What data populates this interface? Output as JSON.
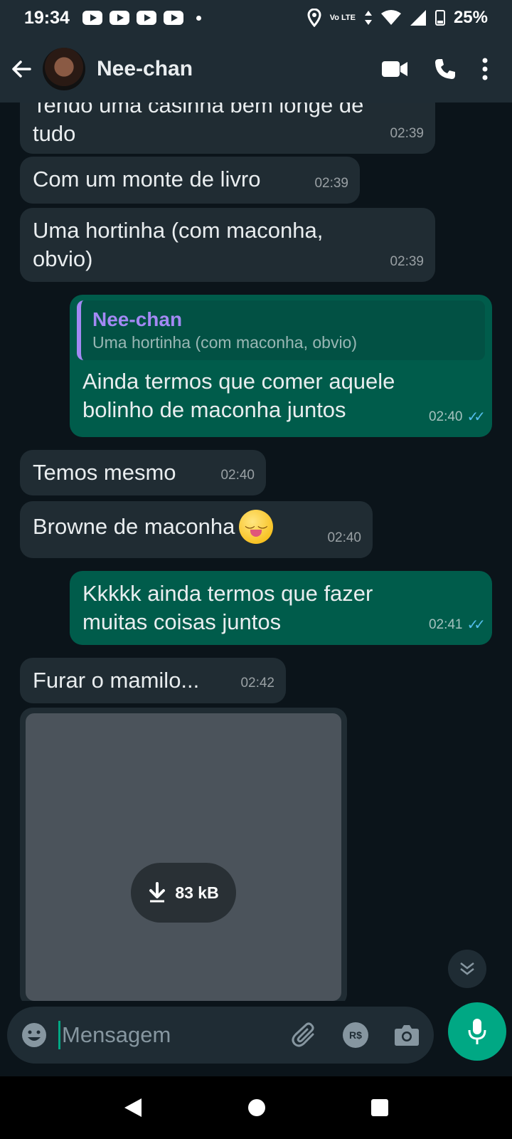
{
  "status_bar": {
    "time": "19:34",
    "network": "Vo LTE",
    "battery": "25%"
  },
  "header": {
    "contact_name": "Nee-chan",
    "icons": [
      "back-arrow-icon",
      "video-call-icon",
      "voice-call-icon",
      "more-options-icon"
    ]
  },
  "messages": [
    {
      "dir": "in",
      "text": "Tendo uma casinha bem longe de tudo",
      "time": "02:39"
    },
    {
      "dir": "in",
      "text": "Com um monte de livro",
      "time": "02:39"
    },
    {
      "dir": "in",
      "text": "Uma hortinha (com maconha, obvio)",
      "time": "02:39"
    },
    {
      "dir": "out",
      "quote_author": "Nee-chan",
      "quote_text": "Uma hortinha (com maconha, obvio)",
      "text": "Ainda termos que comer aquele bolinho de maconha juntos",
      "time": "02:40",
      "status": "read"
    },
    {
      "dir": "in",
      "text": "Temos mesmo",
      "time": "02:40"
    },
    {
      "dir": "in",
      "text": "Browne  de maconha",
      "emoji": "yum-face",
      "time": "02:40"
    },
    {
      "dir": "out",
      "text": "Kkkkk ainda termos que fazer muitas coisas juntos",
      "time": "02:41",
      "status": "read"
    },
    {
      "dir": "in",
      "text": "Furar o mamilo...",
      "time": "02:42"
    }
  ],
  "media": {
    "size_label": "83 kB"
  },
  "composer": {
    "placeholder": "Mensagem",
    "icons": [
      "emoji-icon",
      "attach-icon",
      "payment-icon",
      "camera-icon",
      "mic-icon"
    ]
  },
  "colors": {
    "incoming_bubble": "#202c33",
    "outgoing_bubble": "#005c4b",
    "accent": "#00a884",
    "quote_author": "#a389f4",
    "read_ticks": "#53bdeb"
  }
}
